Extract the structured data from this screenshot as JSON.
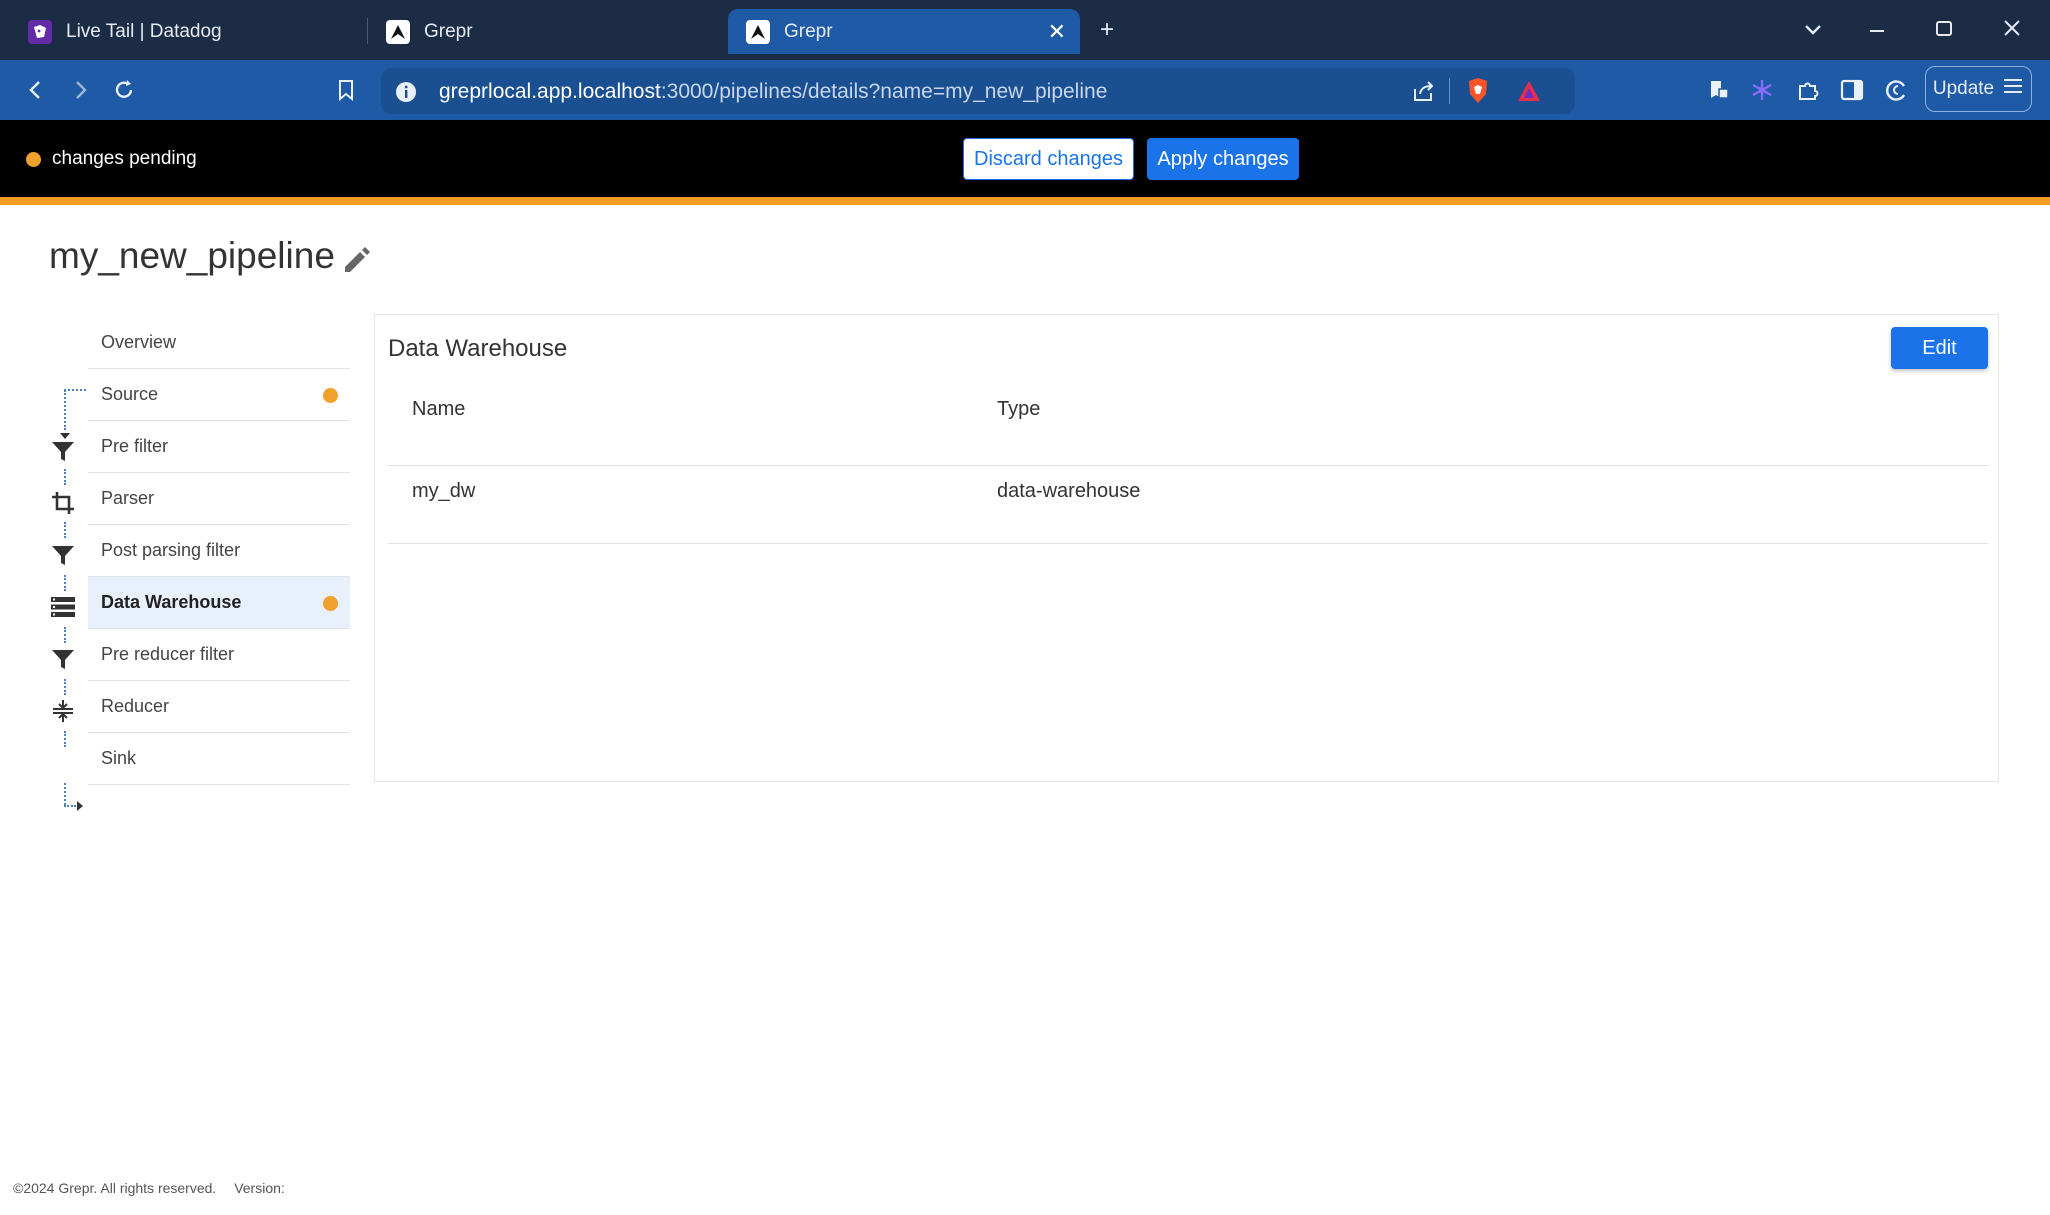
{
  "browser": {
    "tabs": [
      {
        "title": "Live Tail | Datadog",
        "active": false
      },
      {
        "title": "Grepr",
        "active": false
      },
      {
        "title": "Grepr",
        "active": true
      }
    ],
    "url_host": "greprlocal.app.localhost",
    "url_rest": ":3000/pipelines/details?name=my_new_pipeline",
    "update_label": "Update",
    "accent": "#1e5aa6"
  },
  "pending": {
    "status": "changes pending",
    "discard_label": "Discard changes",
    "apply_label": "Apply changes",
    "indicator_color": "#f0a02c"
  },
  "page": {
    "title": "my_new_pipeline"
  },
  "nav": {
    "items": [
      {
        "label": "Overview",
        "icon": "none",
        "active": false,
        "pending": false
      },
      {
        "label": "Source",
        "icon": "none",
        "active": false,
        "pending": true
      },
      {
        "label": "Pre filter",
        "icon": "filter-icon",
        "active": false,
        "pending": false
      },
      {
        "label": "Parser",
        "icon": "crop-icon",
        "active": false,
        "pending": false
      },
      {
        "label": "Post parsing filter",
        "icon": "filter-icon",
        "active": false,
        "pending": false
      },
      {
        "label": "Data Warehouse",
        "icon": "storage-icon",
        "active": true,
        "pending": true
      },
      {
        "label": "Pre reducer filter",
        "icon": "filter-icon",
        "active": false,
        "pending": false
      },
      {
        "label": "Reducer",
        "icon": "compress-icon",
        "active": false,
        "pending": false
      },
      {
        "label": "Sink",
        "icon": "none",
        "active": false,
        "pending": false
      }
    ]
  },
  "panel": {
    "title": "Data Warehouse",
    "edit_label": "Edit",
    "columns": [
      "Name",
      "Type"
    ],
    "rows": [
      [
        "my_dw",
        "data-warehouse"
      ]
    ]
  },
  "footer": {
    "copyright": "©2024 Grepr. All rights reserved.",
    "version_label": "Version:"
  }
}
